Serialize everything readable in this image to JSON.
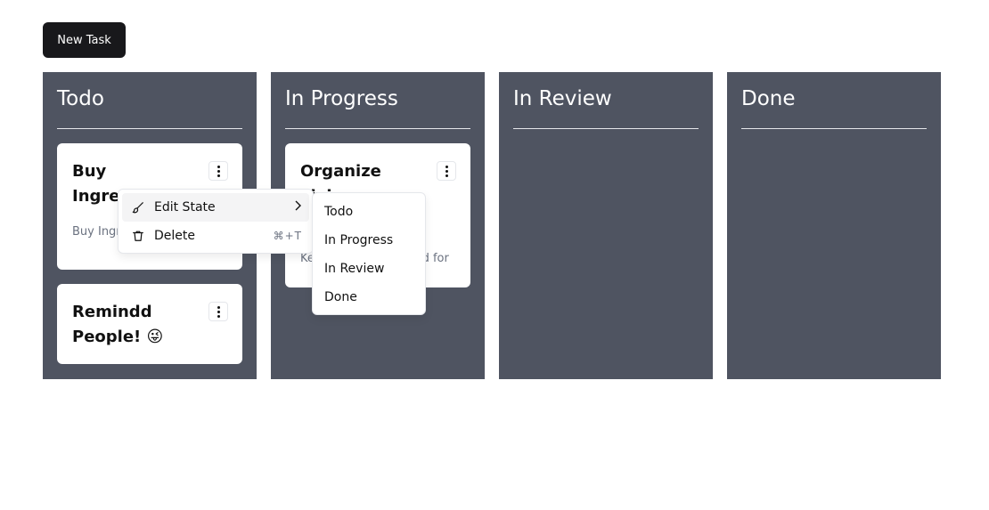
{
  "toolbar": {
    "new_task_label": "New Task"
  },
  "columns": [
    {
      "title": "Todo",
      "cards": [
        {
          "title": "Buy Ingredients",
          "description": "Buy Ingredients for dinner"
        },
        {
          "title": "Remindd People! 😜",
          "description": ""
        }
      ]
    },
    {
      "title": "In Progress",
      "cards": [
        {
          "title": "Organize Living",
          "description": "Keep things organized for"
        }
      ]
    },
    {
      "title": "In Review",
      "cards": []
    },
    {
      "title": "Done",
      "cards": []
    }
  ],
  "context_menu": {
    "items": [
      {
        "label": "Edit State",
        "icon": "brush-icon",
        "has_submenu": true
      },
      {
        "label": "Delete",
        "icon": "trash-icon",
        "shortcut": "⌘+T"
      }
    ],
    "submenu": [
      "Todo",
      "In Progress",
      "In Review",
      "Done"
    ]
  }
}
